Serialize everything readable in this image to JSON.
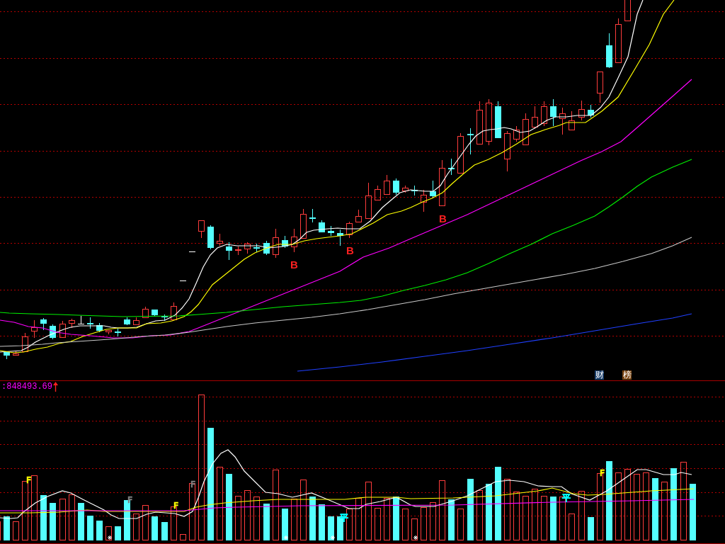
{
  "main_chart": {
    "signals": [
      "B",
      "B",
      "B"
    ],
    "badges": [
      {
        "text": "财",
        "color": "#1b3f6b"
      },
      {
        "text": "榜",
        "color": "#7a4512"
      }
    ]
  },
  "volume_chart": {
    "reading": ":848493.69",
    "markers": [
      {
        "text": "F",
        "color": "#ffff00"
      },
      {
        "text": "F",
        "color": "#808080"
      },
      {
        "text": "F",
        "color": "#ffff00"
      },
      {
        "text": "F",
        "color": "#808080"
      },
      {
        "text": "平",
        "color": "#00ffff"
      },
      {
        "text": "平",
        "color": "#00ffff"
      },
      {
        "text": "F",
        "color": "#ffff00"
      }
    ]
  }
}
